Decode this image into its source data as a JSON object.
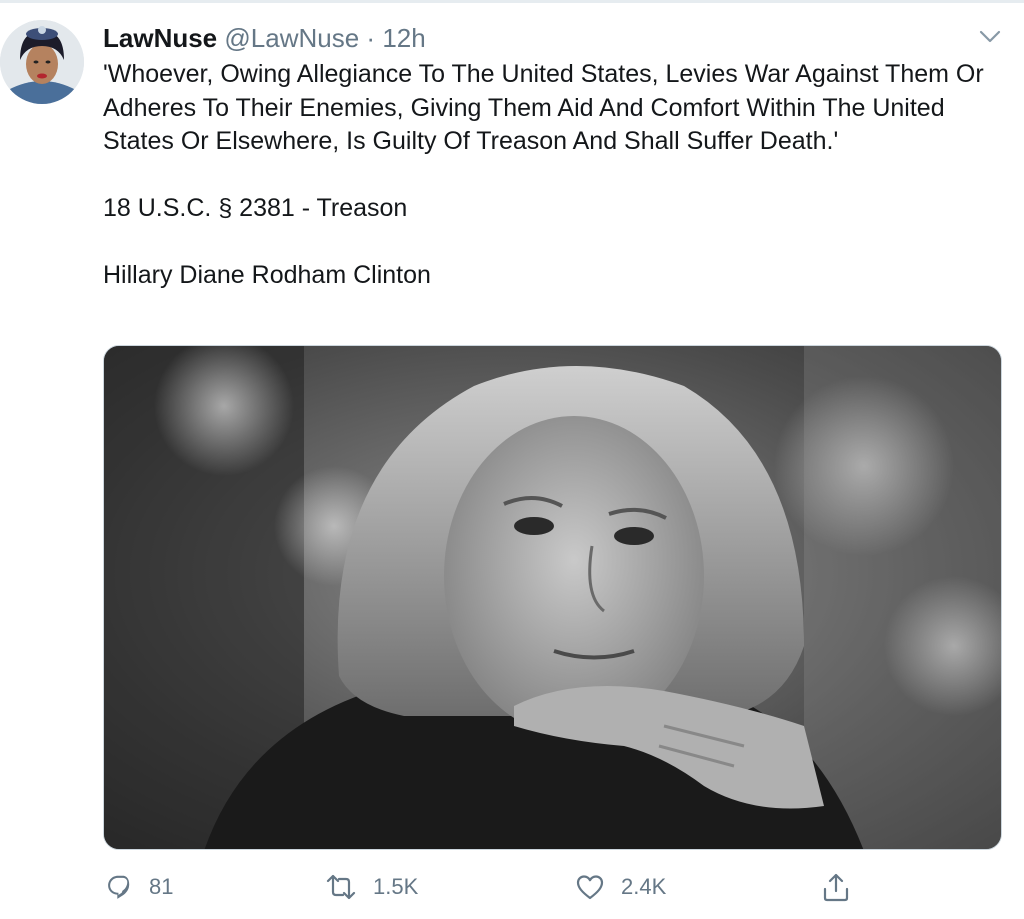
{
  "tweet": {
    "display_name": "LawNuse",
    "handle": "@LawNuse",
    "separator": "·",
    "time": "12h",
    "paragraphs": [
      "'Whoever, Owing Allegiance To The United States, Levies War Against Them Or Adheres To Their Enemies, Giving Them Aid And Comfort Within The United States Or Elsewhere, Is Guilty Of Treason And Shall Suffer Death.'",
      "18 U.S.C. § 2381 - Treason",
      "Hillary Diane Rodham Clinton"
    ],
    "actions": {
      "replies": "81",
      "retweets": "1.5K",
      "likes": "2.4K"
    }
  },
  "icons": {
    "caret": "chevron-down-icon",
    "reply": "reply-icon",
    "retweet": "retweet-icon",
    "like": "heart-icon",
    "share": "share-icon"
  },
  "colors": {
    "text": "#14171a",
    "secondary": "#657786",
    "border": "#ccd6dd"
  }
}
